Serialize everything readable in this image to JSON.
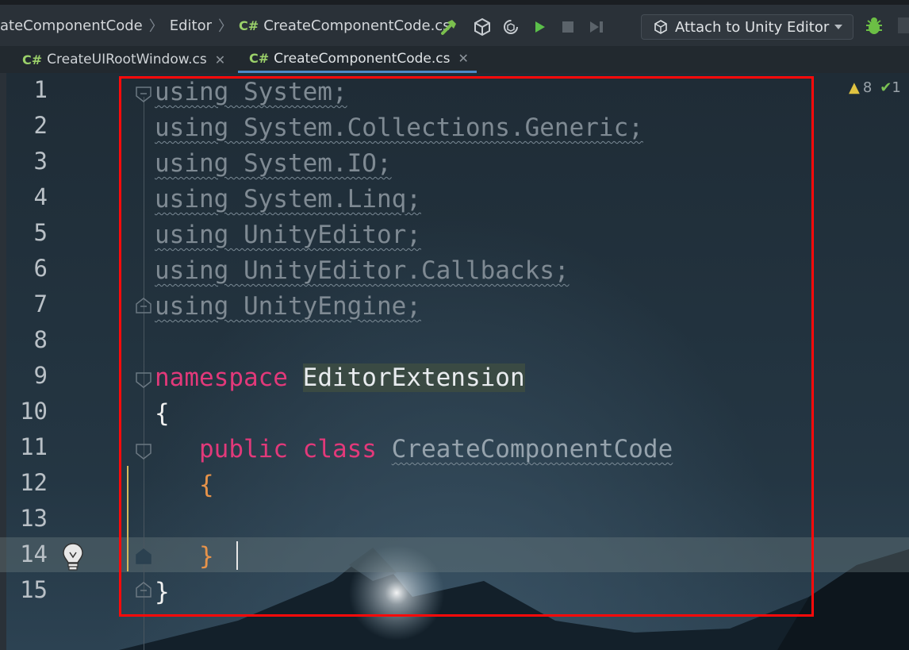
{
  "breadcrumb": {
    "project": "ateComponentCode",
    "folder": "Editor",
    "lang_badge": "C#",
    "file": "CreateComponentCode.cs"
  },
  "toolbar": {
    "attach_label": "Attach to Unity Editor"
  },
  "tabs": [
    {
      "badge": "C#",
      "label": "CreateUIRootWindow.cs",
      "active": false
    },
    {
      "badge": "C#",
      "label": "CreateComponentCode.cs",
      "active": true
    }
  ],
  "inspection": {
    "warnings": "8",
    "ok": "1"
  },
  "editor": {
    "line_numbers": [
      "1",
      "2",
      "3",
      "4",
      "5",
      "6",
      "7",
      "8",
      "9",
      "10",
      "11",
      "12",
      "13",
      "14",
      "15"
    ],
    "lines": {
      "l1": "using System;",
      "l2": "using System.Collections.Generic;",
      "l3": "using System.IO;",
      "l4": "using System.Linq;",
      "l5": "using UnityEditor;",
      "l6": "using UnityEditor.Callbacks;",
      "l7": "using UnityEngine;",
      "l9_kw": "namespace",
      "l9_name": "EditorExtension",
      "l10": "{",
      "l11_kw1": "public",
      "l11_kw2": "class",
      "l11_name": "CreateComponentCode",
      "l12": "{",
      "l14": "}",
      "l15": "}"
    }
  },
  "colors": {
    "keyword": "#e2397a",
    "brace_inner": "#e7934a",
    "highlight_box": "#ff0a0a"
  }
}
